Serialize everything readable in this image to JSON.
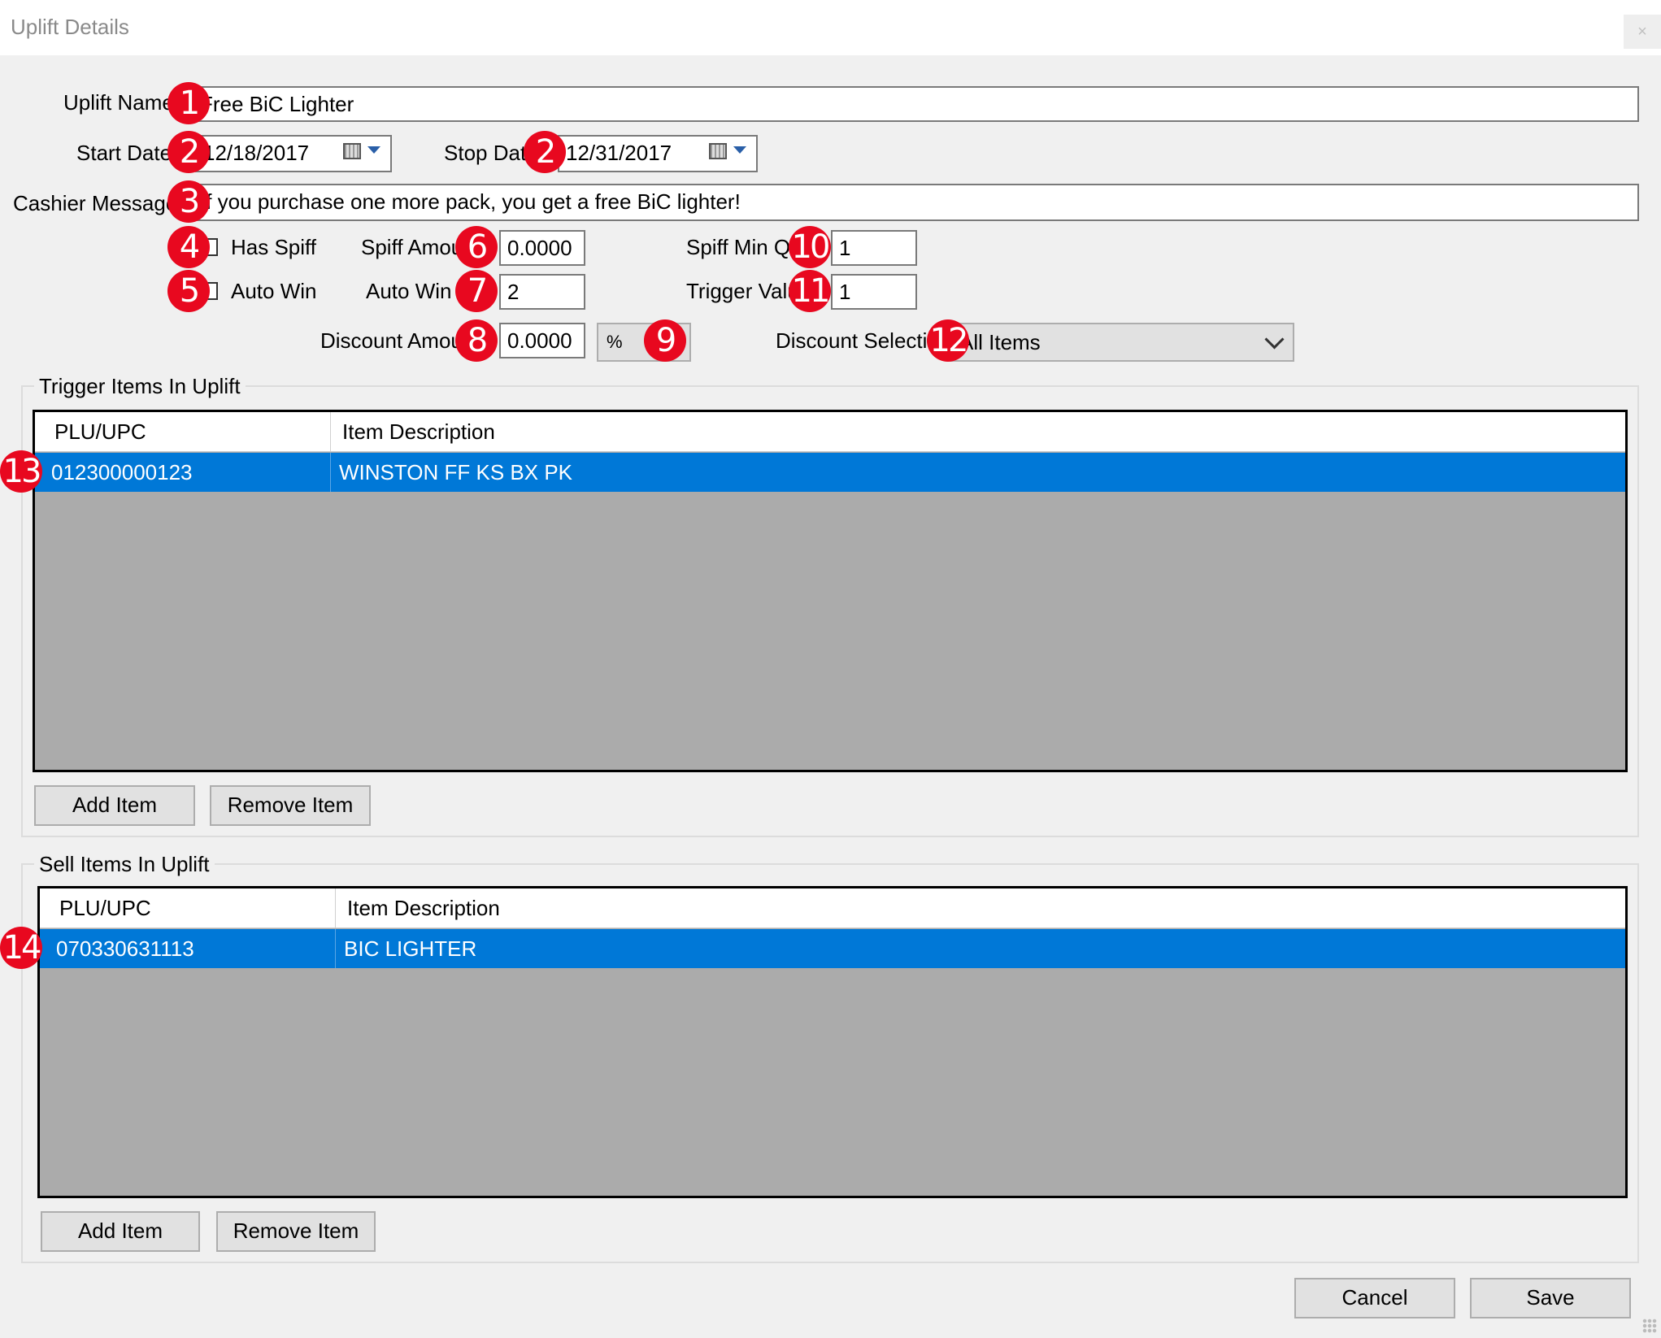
{
  "window": {
    "title": "Uplift Details",
    "close_glyph": "×"
  },
  "form": {
    "uplift_name_label": "Uplift Name",
    "uplift_name_value": "Free BiC Lighter",
    "start_date_label": "Start Date",
    "start_date_value": "12/18/2017",
    "stop_date_label": "Stop Date",
    "stop_date_value": "12/31/2017",
    "cashier_message_label": "Cashier Message",
    "cashier_message_value": "If you purchase one more pack, you get a free BiC lighter!",
    "has_spiff_label": "Has Spiff",
    "has_spiff_checked": false,
    "auto_win_check_label": "Auto Win",
    "auto_win_checked": false,
    "spiff_amount_label": "Spiff Amount",
    "spiff_amount_value": "0.0000",
    "auto_win_label": "Auto Win",
    "auto_win_value": "2",
    "discount_amount_label": "Discount Amount",
    "discount_amount_value": "0.0000",
    "discount_type_value": "%",
    "spiff_min_qty_label": "Spiff Min Qty",
    "spiff_min_qty_value": "1",
    "trigger_value_label": "Trigger Value",
    "trigger_value_value": "1",
    "discount_selection_label": "Discount Selection",
    "discount_selection_value": "All Items"
  },
  "trigger_items": {
    "group_label": "Trigger Items In Uplift",
    "columns": [
      "PLU/UPC",
      "Item Description"
    ],
    "rows": [
      {
        "plu": "012300000123",
        "description": "WINSTON FF KS BX PK"
      }
    ],
    "add_label": "Add Item",
    "remove_label": "Remove Item"
  },
  "sell_items": {
    "group_label": "Sell Items In Uplift",
    "columns": [
      "PLU/UPC",
      "Item Description"
    ],
    "rows": [
      {
        "plu": "070330631113",
        "description": "BIC LIGHTER"
      }
    ],
    "add_label": "Add Item",
    "remove_label": "Remove Item"
  },
  "footer": {
    "cancel_label": "Cancel",
    "save_label": "Save"
  },
  "badges": [
    "1",
    "2",
    "2",
    "3",
    "4",
    "5",
    "6",
    "7",
    "8",
    "9",
    "10",
    "11",
    "12",
    "13",
    "14"
  ],
  "colors": {
    "selection": "#0078d7",
    "badge": "#e8081f",
    "grid_background": "#ababab"
  }
}
